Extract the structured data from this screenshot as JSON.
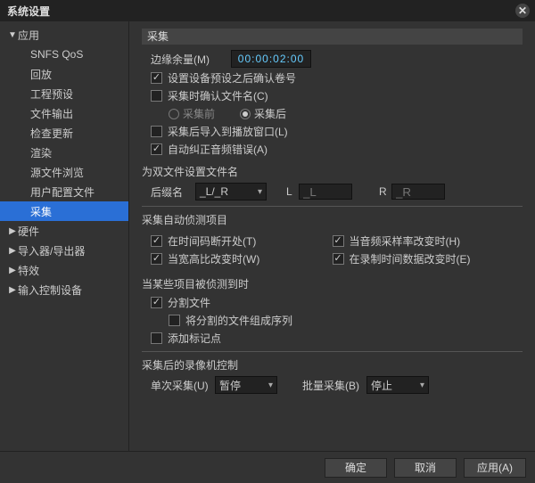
{
  "window": {
    "title": "系统设置"
  },
  "sidebar": {
    "items": [
      {
        "label": "应用",
        "expanded": true,
        "children": [
          {
            "label": "SNFS QoS"
          },
          {
            "label": "回放"
          },
          {
            "label": "工程预设"
          },
          {
            "label": "文件输出"
          },
          {
            "label": "检查更新"
          },
          {
            "label": "渲染"
          },
          {
            "label": "源文件浏览"
          },
          {
            "label": "用户配置文件"
          },
          {
            "label": "采集",
            "selected": true
          }
        ]
      },
      {
        "label": "硬件",
        "expanded": false
      },
      {
        "label": "导入器/导出器",
        "expanded": false
      },
      {
        "label": "特效",
        "expanded": false
      },
      {
        "label": "输入控制设备",
        "expanded": false
      }
    ]
  },
  "panel": {
    "title": "采集",
    "margin": {
      "label": "边缘余量(M)",
      "timecode": "00:00:02:00"
    },
    "confirmReel": {
      "checked": true,
      "label": "设置设备预设之后确认卷号"
    },
    "confirmFilename": {
      "checked": false,
      "label": "采集时确认文件名(C)"
    },
    "confirmTiming": {
      "before": {
        "label": "采集前"
      },
      "after": {
        "label": "采集后",
        "selected": true
      }
    },
    "importToPlayer": {
      "checked": false,
      "label": "采集后导入到播放窗口(L)"
    },
    "fixAudio": {
      "checked": true,
      "label": "自动纠正音频错误(A)"
    },
    "dualFile": {
      "title": "为双文件设置文件名",
      "suffixLabel": "后缀名",
      "suffixValue": "_L/_R",
      "L": {
        "label": "L",
        "placeholder": "_L"
      },
      "R": {
        "label": "R",
        "placeholder": "_R"
      }
    },
    "autodetect": {
      "title": "采集自动侦测项目",
      "items": [
        {
          "checked": true,
          "label": "在时间码断开处(T)"
        },
        {
          "checked": true,
          "label": "当音频采样率改变时(H)"
        },
        {
          "checked": true,
          "label": "当宽高比改变时(W)"
        },
        {
          "checked": true,
          "label": "在录制时间数据改变时(E)"
        }
      ]
    },
    "onDetect": {
      "title": "当某些项目被侦测到时",
      "split": {
        "checked": true,
        "label": "分割文件"
      },
      "group": {
        "checked": false,
        "label": "将分割的文件组成序列"
      },
      "addMarker": {
        "checked": false,
        "label": "添加标记点"
      }
    },
    "recorderCtrl": {
      "title": "采集后的录像机控制",
      "single": {
        "label": "单次采集(U)",
        "value": "暂停"
      },
      "batch": {
        "label": "批量采集(B)",
        "value": "停止"
      }
    }
  },
  "footer": {
    "ok": "确定",
    "cancel": "取消",
    "apply": "应用(A)"
  }
}
